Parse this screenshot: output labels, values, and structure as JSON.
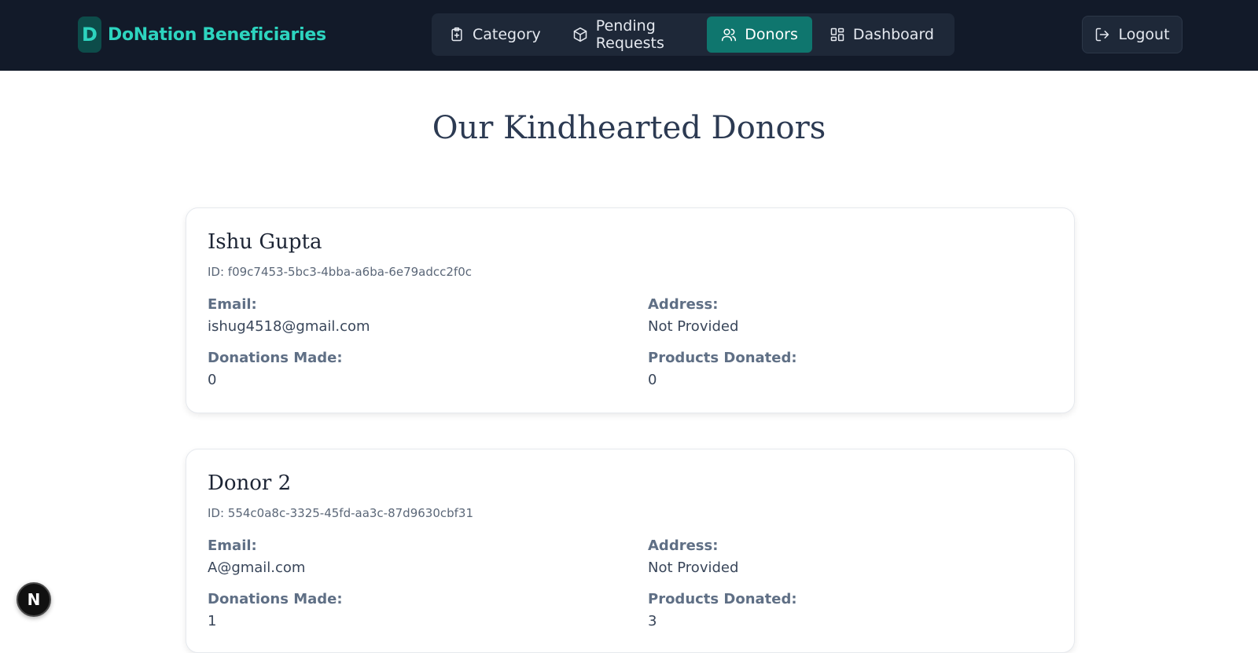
{
  "brand": {
    "badge_letter": "D",
    "name": "DoNation Beneficiaries"
  },
  "nav": {
    "items": [
      {
        "label": "Category",
        "icon": "clipboard-plus-icon",
        "active": false
      },
      {
        "label": "Pending Requests",
        "icon": "package-icon",
        "active": false
      },
      {
        "label": "Donors",
        "icon": "users-icon",
        "active": true
      },
      {
        "label": "Dashboard",
        "icon": "layout-grid-icon",
        "active": false
      }
    ],
    "logout_label": "Logout"
  },
  "page": {
    "title": "Our Kindhearted Donors"
  },
  "labels": {
    "email": "Email:",
    "address": "Address:",
    "donations_made": "Donations Made:",
    "products_donated": "Products Donated:"
  },
  "donors": [
    {
      "name": "Ishu Gupta",
      "id_text": "ID: f09c7453-5bc3-4bba-a6ba-6e79adcc2f0c",
      "email": "ishug4518@gmail.com",
      "address": "Not Provided",
      "donations_made": "0",
      "products_donated": "0"
    },
    {
      "name": "Donor 2",
      "id_text": "ID: 554c0a8c-3325-45fd-aa3c-87d9630cbf31",
      "email": "A@gmail.com",
      "address": "Not Provided",
      "donations_made": "1",
      "products_donated": "3"
    }
  ],
  "floating_badge": {
    "letter": "N"
  },
  "colors": {
    "accent": "#2dd4bf",
    "active_nav": "#0f766e",
    "topbar": "#121a29"
  }
}
